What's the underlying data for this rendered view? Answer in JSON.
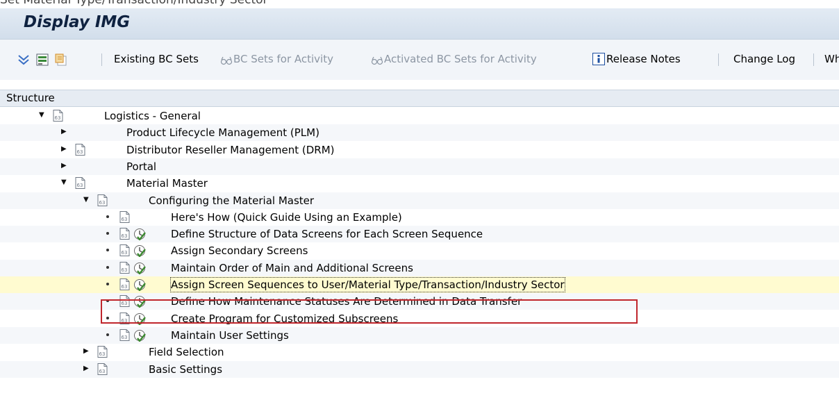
{
  "window": {
    "cropped_title": "Set Material Type/Transaction/Industry Sector",
    "title": "Display IMG"
  },
  "toolbar": {
    "icons": [
      "expand-subtree-icon",
      "bc-set-icon",
      "additional-info-icon"
    ],
    "existing_bc_sets": "Existing BC Sets",
    "bc_sets_for_activity": "BC Sets for Activity",
    "activated_bc_sets_for_activity": "Activated BC Sets for Activity",
    "release_notes": "Release Notes",
    "change_log": "Change Log",
    "where_used": "Wh"
  },
  "structure": {
    "header": "Structure",
    "nodes": [
      {
        "label": "Logistics - General",
        "level": 0,
        "expander": "expanded",
        "doc_icon": true,
        "activity_icon": false
      },
      {
        "label": "Product Lifecycle Management (PLM)",
        "level": 1,
        "expander": "collapsed",
        "doc_icon": false,
        "activity_icon": false
      },
      {
        "label": "Distributor Reseller Management (DRM)",
        "level": 1,
        "expander": "collapsed",
        "doc_icon": true,
        "activity_icon": false
      },
      {
        "label": "Portal",
        "level": 1,
        "expander": "collapsed",
        "doc_icon": false,
        "activity_icon": false
      },
      {
        "label": "Material Master",
        "level": 1,
        "expander": "expanded",
        "doc_icon": true,
        "activity_icon": false
      },
      {
        "label": "Configuring the Material Master",
        "level": 2,
        "expander": "expanded",
        "doc_icon": true,
        "activity_icon": false
      },
      {
        "label": "Here's How (Quick Guide Using an Example)",
        "level": 3,
        "expander": "leaf",
        "doc_icon": true,
        "activity_icon": false
      },
      {
        "label": "Define Structure of Data Screens for Each Screen Sequence",
        "level": 3,
        "expander": "leaf",
        "doc_icon": true,
        "activity_icon": true
      },
      {
        "label": "Assign Secondary Screens",
        "level": 3,
        "expander": "leaf",
        "doc_icon": true,
        "activity_icon": true
      },
      {
        "label": "Maintain Order of Main and Additional Screens",
        "level": 3,
        "expander": "leaf",
        "doc_icon": true,
        "activity_icon": true
      },
      {
        "label": "Assign Screen Sequences to User/Material Type/Transaction/Industry Sector",
        "level": 3,
        "expander": "leaf",
        "doc_icon": true,
        "activity_icon": true,
        "selected": true
      },
      {
        "label": "Define How Maintenance Statuses Are Determined in Data Transfer",
        "level": 3,
        "expander": "leaf",
        "doc_icon": true,
        "activity_icon": true
      },
      {
        "label": "Create Program for Customized Subscreens",
        "level": 3,
        "expander": "leaf",
        "doc_icon": true,
        "activity_icon": true
      },
      {
        "label": "Maintain User Settings",
        "level": 3,
        "expander": "leaf",
        "doc_icon": true,
        "activity_icon": true
      },
      {
        "label": "Field Selection",
        "level": 2,
        "expander": "collapsed",
        "doc_icon": true,
        "activity_icon": false
      },
      {
        "label": "Basic Settings",
        "level": 2,
        "expander": "collapsed",
        "doc_icon": true,
        "activity_icon": false
      }
    ]
  },
  "colors": {
    "title_bar": "#d2deeb",
    "selected_row": "#fffbd0",
    "highlight_border": "#c0262c",
    "activity_green": "#3b8a2f"
  }
}
